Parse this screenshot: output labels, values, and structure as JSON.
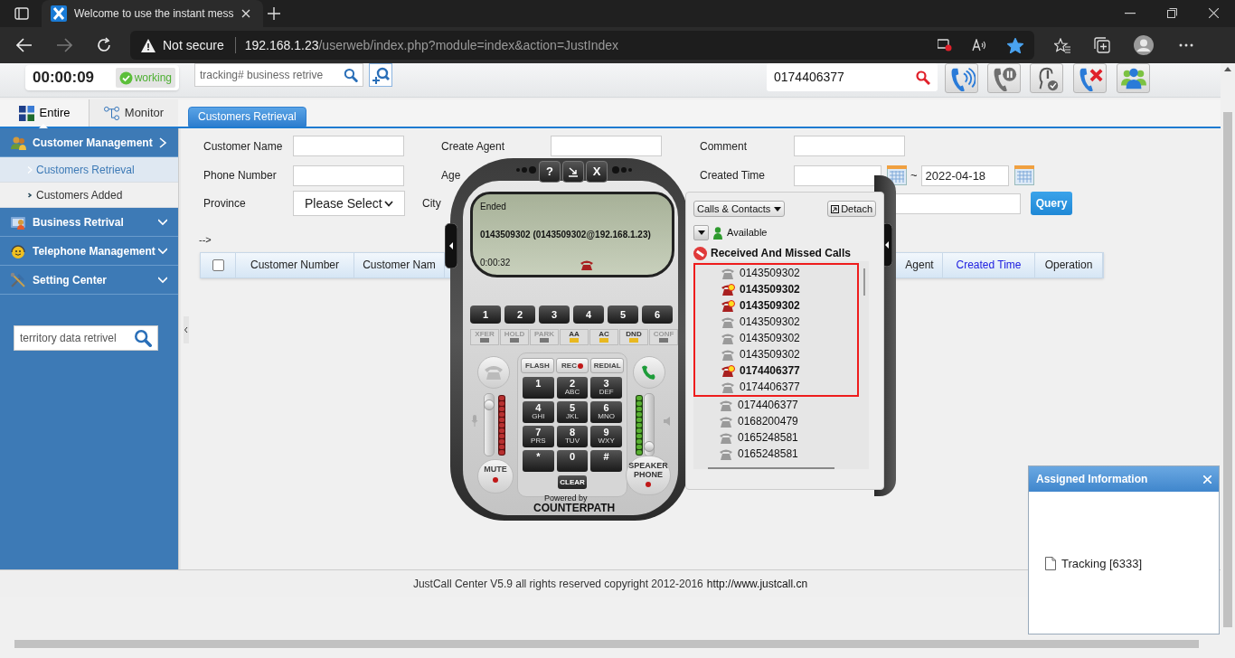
{
  "browser": {
    "tab_title": "Welcome to use the instant mess",
    "security": "Not secure",
    "url_host": "192.168.1.23",
    "url_path": "/userweb/index.php?module=index&action=JustIndex",
    "favorite": true
  },
  "header": {
    "timer": "00:00:09",
    "status": "working",
    "search": {
      "placeholder": "tracking# business retrive"
    },
    "phone_search": {
      "value": "0174406377"
    }
  },
  "sidebar": {
    "tabs": [
      {
        "label": "Entire",
        "selected": true
      },
      {
        "label": "Monitor",
        "selected": false
      }
    ],
    "menu": [
      {
        "label": "Customer Management",
        "expanded": true,
        "children": [
          {
            "label": "Customers Retrieval",
            "selected": true
          },
          {
            "label": "Customers Added",
            "selected": false
          }
        ]
      },
      {
        "label": "Business Retrival",
        "expanded": false
      },
      {
        "label": "Telephone Management",
        "expanded": false
      },
      {
        "label": "Setting Center",
        "expanded": false
      }
    ],
    "search": {
      "placeholder": "territory data retrivel"
    }
  },
  "content_tabs": [
    {
      "label": "Customers Retrieval",
      "selected": true
    }
  ],
  "form": {
    "customer_name": {
      "label": "Customer Name"
    },
    "create_agent": {
      "label": "Create Agent"
    },
    "comment": {
      "label": "Comment"
    },
    "phone_number": {
      "label": "Phone Number"
    },
    "age": {
      "label": "Age"
    },
    "created_time": {
      "label": "Created Time",
      "separator": "~",
      "end_value": "2022-04-18"
    },
    "province": {
      "label": "Province",
      "value": "Please Select"
    },
    "city": {
      "label": "City"
    },
    "query_button": "Query"
  },
  "arrow_text": "-->",
  "table": {
    "select_all": false,
    "columns": [
      {
        "label": "Customer Number",
        "kind": "plain"
      },
      {
        "label": "Customer Nam",
        "kind": "plain"
      },
      {
        "label": "Agent",
        "kind": "plain"
      },
      {
        "label": "Created Time",
        "kind": "sortable"
      },
      {
        "label": "Operation",
        "kind": "plain"
      }
    ]
  },
  "footer": {
    "text": "JustCall Center V5.9 all rights reserved copyright 2012-2016",
    "link": "http://www.justcall.cn"
  },
  "softphone": {
    "top_buttons": [
      {
        "kind": "text",
        "label": "?"
      },
      {
        "kind": "icon"
      },
      {
        "kind": "text",
        "label": "X"
      }
    ],
    "screen": {
      "status": "Ended",
      "caller": "0143509302 (0143509302@192.168.1.23)",
      "duration": "0:00:32"
    },
    "lines": [
      "1",
      "2",
      "3",
      "4",
      "5",
      "6"
    ],
    "features": [
      {
        "label": "XFER",
        "on": false
      },
      {
        "label": "HOLD",
        "on": false
      },
      {
        "label": "PARK",
        "on": false
      },
      {
        "label": "AA",
        "on": true
      },
      {
        "label": "AC",
        "on": true
      },
      {
        "label": "DND",
        "on": true
      },
      {
        "label": "CONF",
        "on": false
      }
    ],
    "function_keys": [
      {
        "label": "FLASH",
        "indicator": false
      },
      {
        "label": "REC",
        "indicator": true
      },
      {
        "label": "REDIAL",
        "indicator": false
      }
    ],
    "keys": [
      {
        "digit": "1"
      },
      {
        "digit": "2",
        "letters": "ABC"
      },
      {
        "digit": "3",
        "letters": "DEF"
      },
      {
        "digit": "4",
        "letters": "GHI"
      },
      {
        "digit": "5",
        "letters": "JKL"
      },
      {
        "digit": "6",
        "letters": "MNO"
      },
      {
        "digit": "7",
        "letters": "PRS"
      },
      {
        "digit": "8",
        "letters": "TUV"
      },
      {
        "digit": "9",
        "letters": "WXY"
      },
      {
        "digit": "*"
      },
      {
        "digit": "0"
      },
      {
        "digit": "#"
      }
    ],
    "clear": "CLEAR",
    "mute": "MUTE",
    "speaker": "SPEAKER PHONE",
    "mic": {
      "level": 0.9
    },
    "speaker_volume": {
      "level": 0.1
    },
    "powered_by": "Powered by",
    "brand": "COUNTERPATH",
    "panel": {
      "view": "Calls & Contacts",
      "detach": "Detach",
      "presence": "Available",
      "list_title": "Received And Missed Calls",
      "calls": [
        {
          "number": "0143509302",
          "missed": false,
          "highlighted": true
        },
        {
          "number": "0143509302",
          "missed": true,
          "highlighted": true
        },
        {
          "number": "0143509302",
          "missed": true,
          "highlighted": true
        },
        {
          "number": "0143509302",
          "missed": false,
          "highlighted": true
        },
        {
          "number": "0143509302",
          "missed": false,
          "highlighted": true
        },
        {
          "number": "0143509302",
          "missed": false,
          "highlighted": true
        },
        {
          "number": "0174406377",
          "missed": true,
          "highlighted": true
        },
        {
          "number": "0174406377",
          "missed": false,
          "highlighted": true
        },
        {
          "number": "0174406377",
          "missed": false,
          "highlighted": false
        },
        {
          "number": "0168200479",
          "missed": false,
          "highlighted": false
        },
        {
          "number": "0165248581",
          "missed": false,
          "highlighted": false
        },
        {
          "number": "0165248581",
          "missed": false,
          "highlighted": false
        }
      ]
    }
  },
  "assigned_panel": {
    "title": "Assigned Information",
    "items": [
      "Tracking [6333]"
    ]
  }
}
